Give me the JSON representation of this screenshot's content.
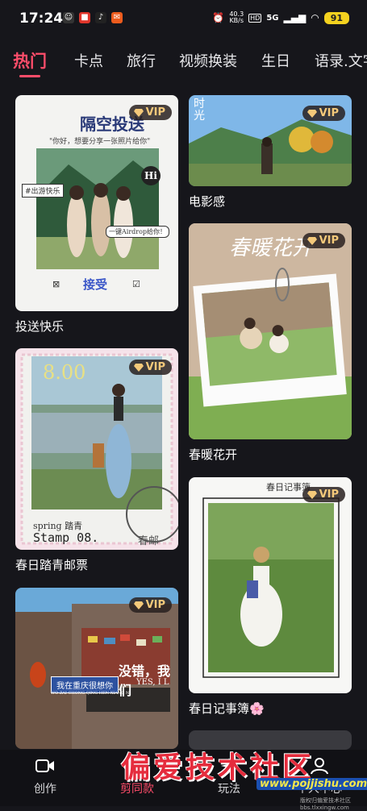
{
  "status_bar": {
    "time": "17:24",
    "net_speed_value": "40.3",
    "net_speed_unit": "KB/s",
    "signal": "5G",
    "battery": "91"
  },
  "tabs": [
    {
      "label": "热门",
      "active": true
    },
    {
      "label": "卡点",
      "active": false
    },
    {
      "label": "旅行",
      "active": false
    },
    {
      "label": "视频换装",
      "active": false
    },
    {
      "label": "生日",
      "active": false
    },
    {
      "label": "语录.文字",
      "active": false
    }
  ],
  "cards": {
    "c1": {
      "title": "投送快乐",
      "vip": "VIP",
      "heading": "隔空投送",
      "subtext": "\"你好，想要分享一张照片给你\"",
      "tag_left": "#出游快乐",
      "bubble": "Hi",
      "airdrop": "一键Airdrop给你！",
      "accept": "接受"
    },
    "c2": {
      "title": "电影感",
      "vip": "VIP",
      "overlay": "时光"
    },
    "c3": {
      "title": "春暖花开",
      "vip": "VIP",
      "overlay": "春暖花开"
    },
    "c4": {
      "title": "春日踏青邮票",
      "vip": "VIP",
      "number": "8.00",
      "spring": "spring 踏青",
      "stamp": "Stamp 08.",
      "postmark": "春邮"
    },
    "c5": {
      "title": "春日记事簿🌸",
      "vip": "VIP",
      "header": "春日记事簿"
    },
    "c6": {
      "vip": "VIP",
      "sign": "我在重庆很想你",
      "sign_pinyin": "WO ZAI CHONG QING HEN XIANG NI",
      "wall_text": "没错，我们",
      "wall_text2": "YES, I L"
    }
  },
  "bottom_nav": [
    {
      "label": "创作",
      "icon": "video-camera-icon",
      "active": false
    },
    {
      "label": "剪同款",
      "icon": "template-icon",
      "active": true
    },
    {
      "label": "玩法",
      "icon": "sparkle-icon",
      "active": false
    },
    {
      "label": "个人中心",
      "icon": "person-icon",
      "active": false
    }
  ],
  "watermark": {
    "text": "偏爱技术社区",
    "url": "www.pojjishu.com",
    "small": "版权归偏爱技术社区 bbs.tlxxingw.com"
  },
  "colors": {
    "accent": "#ff4d6a",
    "background": "#16161b",
    "vip_gold": "#f4c97a"
  }
}
